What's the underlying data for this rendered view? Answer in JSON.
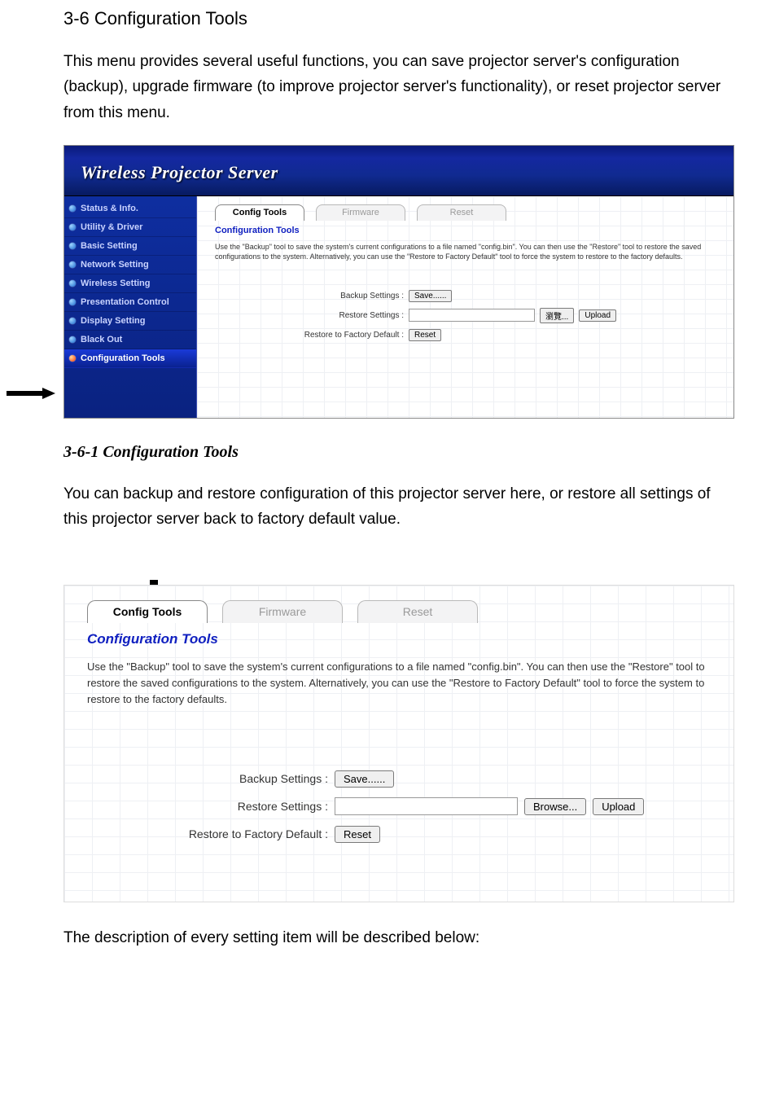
{
  "doc": {
    "section_heading": "3-6 Configuration Tools",
    "intro_para": "This menu provides several useful functions, you can save projector server's configuration (backup), upgrade firmware (to improve projector server's functionality), or reset projector server from this menu.",
    "subsection_heading": "3-6-1 Configuration Tools",
    "sub_para": "You can backup and restore configuration of this projector server here, or restore all settings of this projector server back to factory default value.",
    "closing_para": "The description of every setting item will be described below:"
  },
  "shot1": {
    "header_title": "Wireless Projector Server",
    "sidebar": [
      "Status & Info.",
      "Utility & Driver",
      "Basic Setting",
      "Network Setting",
      "Wireless Setting",
      "Presentation Control",
      "Display Setting",
      "Black Out",
      "Configuration Tools"
    ],
    "tabs": {
      "t0": "Config Tools",
      "t1": "Firmware",
      "t2": "Reset"
    },
    "panel_title": "Configuration Tools",
    "panel_desc": "Use the \"Backup\" tool to save the system's current configurations to a file named \"config.bin\". You can then use the \"Restore\" tool to restore the saved configurations to the system. Alternatively, you can use the \"Restore to Factory Default\" tool to force the system to restore to the factory defaults.",
    "form": {
      "backup_label": "Backup Settings :",
      "backup_btn": "Save......",
      "restore_label": "Restore Settings :",
      "browse_btn": "瀏覽...",
      "upload_btn": "Upload",
      "reset_label": "Restore to Factory Default :",
      "reset_btn": "Reset"
    }
  },
  "shot2": {
    "tabs": {
      "t0": "Config Tools",
      "t1": "Firmware",
      "t2": "Reset"
    },
    "panel_title": "Configuration Tools",
    "panel_desc": "Use the \"Backup\" tool to save the system's current configurations to a file named \"config.bin\". You can then use the \"Restore\" tool to restore the saved configurations to the system. Alternatively, you can use the \"Restore to Factory Default\" tool to force the system to restore to the factory defaults.",
    "form": {
      "backup_label": "Backup Settings :",
      "backup_btn": "Save......",
      "restore_label": "Restore Settings :",
      "browse_btn": "Browse...",
      "upload_btn": "Upload",
      "reset_label": "Restore to Factory Default :",
      "reset_btn": "Reset"
    }
  }
}
